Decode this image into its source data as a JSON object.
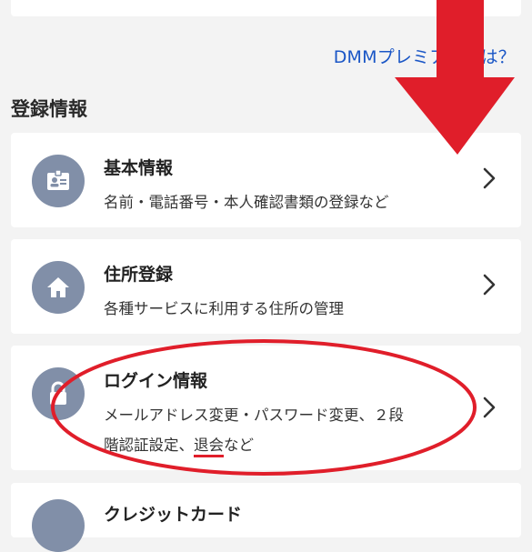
{
  "header": {
    "premium_link": "DMMプレミアムとは？"
  },
  "section": {
    "title": "登録情報"
  },
  "items": [
    {
      "title": "基本情報",
      "desc": "名前・電話番号・本人確認書類の登録など",
      "icon": "id-card-icon"
    },
    {
      "title": "住所登録",
      "desc": "各種サービスに利用する住所の管理",
      "icon": "home-icon"
    },
    {
      "title": "ログイン情報",
      "desc_line1": "メールアドレス変更・パスワード変更、２段",
      "desc_line2_prefix": "階認証設定、",
      "desc_line2_highlight": "退会",
      "desc_line2_suffix": "など",
      "icon": "lock-icon"
    },
    {
      "title": "クレジットカード",
      "icon": "card-icon"
    }
  ],
  "colors": {
    "link": "#1a56c6",
    "icon_bg": "#818fa8",
    "annotation_red": "#e01e2a"
  }
}
